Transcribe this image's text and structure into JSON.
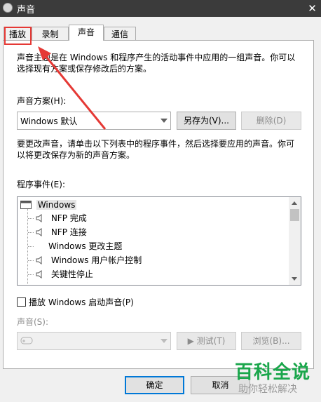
{
  "window": {
    "title": "声音",
    "close_glyph": "✕"
  },
  "tabs": [
    {
      "label": "播放"
    },
    {
      "label": "录制"
    },
    {
      "label": "声音"
    },
    {
      "label": "通信"
    }
  ],
  "sounds_tab": {
    "intro": "声音主题是在 Windows 和程序产生的活动事件中应用的一组声音。你可以选择现有方案或保存修改后的方案。",
    "scheme_label": "声音方案(H):",
    "scheme_value": "Windows 默认",
    "save_as_button": "另存为(V)...",
    "delete_button": "删除(D)",
    "change_instructions": "要更改声音，请单击以下列表中的程序事件，然后选择要应用的声音。你可以将更改保存为新的声音方案。",
    "events_label": "程序事件(E):",
    "events": [
      {
        "label": "Windows"
      },
      {
        "label": "NFP 完成"
      },
      {
        "label": "NFP 连接"
      },
      {
        "label": "Windows 更改主题"
      },
      {
        "label": "Windows 用户帐户控制"
      },
      {
        "label": "关键性停止"
      }
    ],
    "play_startup_label": "播放 Windows 启动声音(P)",
    "sound_label": "声音(S):",
    "test_button": "▶ 测试(T)",
    "browse_button": "浏览(B)..."
  },
  "footer": {
    "ok_button": "确定",
    "cancel_button": "取消"
  },
  "watermark": {
    "brand": "百科全说",
    "slogan": "助你轻松解决"
  },
  "colors": {
    "titlebar": "#3b3b3b",
    "highlight_box": "#e53935",
    "focus_border": "#0078d7",
    "watermark_green": "#1aa64b"
  }
}
